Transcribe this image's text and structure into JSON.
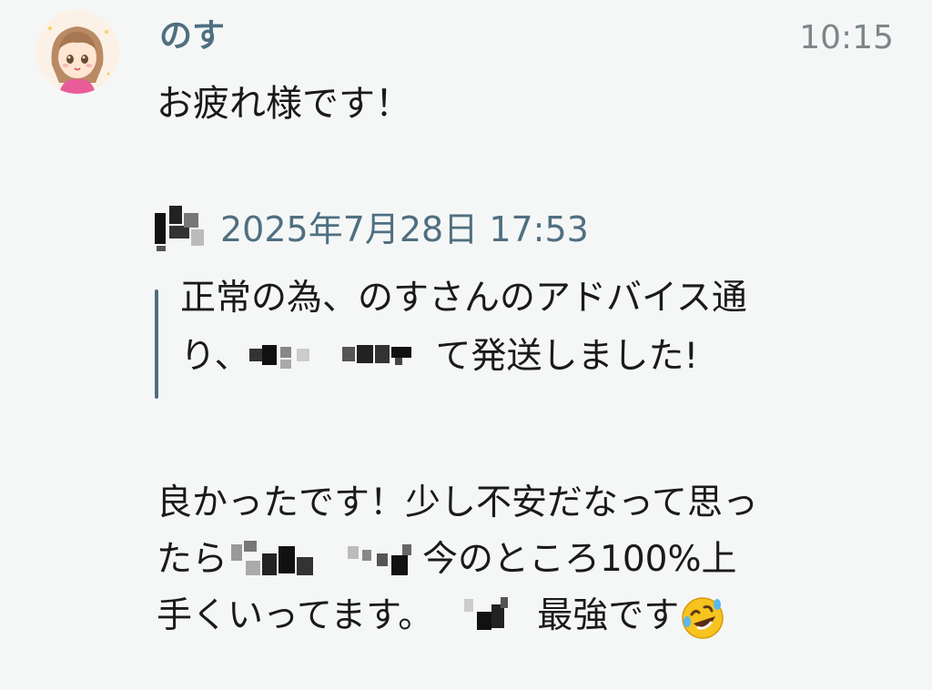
{
  "message": {
    "sender": "のす",
    "time": "10:15",
    "greeting": "お疲れ様です！",
    "quote": {
      "date": "2025年7月28日 17:53",
      "line1": "正常の為、のすさんのアドバイス通",
      "line2_start": "り、",
      "line2_end": "て発送しました!"
    },
    "reply": {
      "line1": "良かったです！少し不安だなって思っ",
      "line2_start": "たら",
      "line2_end": "今のところ100%上",
      "line3_start": "手くいってます。",
      "line3_end": "最強です"
    },
    "icons": {
      "avatar": "avatar-illustration-icon",
      "emoji": "rolling-on-floor-laughing-icon"
    },
    "colors": {
      "name_accent": "#4f6f80",
      "time_gray": "#7e8689",
      "background": "#f5f7f7",
      "text": "#1a1a1a"
    }
  }
}
